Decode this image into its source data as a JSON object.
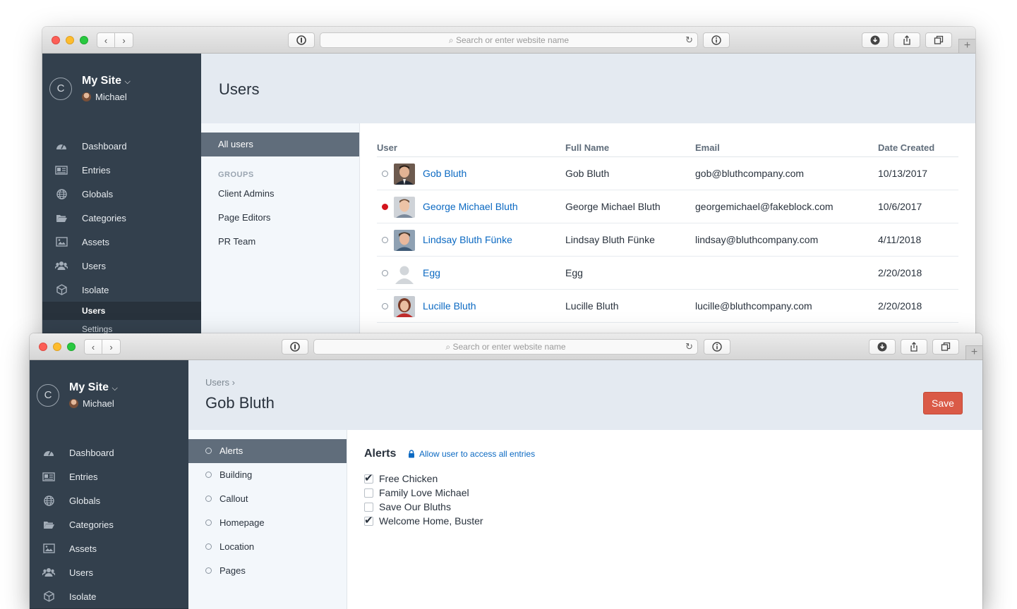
{
  "browser": {
    "address_placeholder": "Search or enter website name"
  },
  "site": {
    "name": "My Site",
    "user": "Michael",
    "logo_letter": "C"
  },
  "nav": {
    "items": [
      {
        "label": "Dashboard",
        "icon": "dashboard-icon"
      },
      {
        "label": "Entries",
        "icon": "entries-icon"
      },
      {
        "label": "Globals",
        "icon": "globe-icon"
      },
      {
        "label": "Categories",
        "icon": "folder-icon"
      },
      {
        "label": "Assets",
        "icon": "image-icon"
      },
      {
        "label": "Users",
        "icon": "users-icon"
      },
      {
        "label": "Isolate",
        "icon": "cube-icon"
      }
    ],
    "subitems": [
      {
        "label": "Users"
      },
      {
        "label": "Settings"
      }
    ]
  },
  "users_page": {
    "title": "Users",
    "sources": {
      "all_users": "All users",
      "groups_heading": "GROUPS",
      "groups": [
        "Client Admins",
        "Page Editors",
        "PR Team"
      ]
    },
    "columns": [
      "User",
      "Full Name",
      "Email",
      "Date Created"
    ],
    "rows": [
      {
        "user": "Gob Bluth",
        "full_name": "Gob Bluth",
        "email": "gob@bluthcompany.com",
        "date": "10/13/2017",
        "status": "off"
      },
      {
        "user": "George Michael Bluth",
        "full_name": "George Michael Bluth",
        "email": "georgemichael@fakeblock.com",
        "date": "10/6/2017",
        "status": "on"
      },
      {
        "user": "Lindsay Bluth Fünke",
        "full_name": "Lindsay Bluth Fünke",
        "email": "lindsay@bluthcompany.com",
        "date": "4/11/2018",
        "status": "off"
      },
      {
        "user": "Egg",
        "full_name": "Egg",
        "email": "",
        "date": "2/20/2018",
        "status": "off"
      },
      {
        "user": "Lucille Bluth",
        "full_name": "Lucille Bluth",
        "email": "lucille@bluthcompany.com",
        "date": "2/20/2018",
        "status": "off"
      }
    ]
  },
  "edit_page": {
    "breadcrumb": "Users",
    "title": "Gob Bluth",
    "save_label": "Save",
    "sections": [
      "Alerts",
      "Building",
      "Callout",
      "Homepage",
      "Location",
      "Pages"
    ],
    "active_section": "Alerts",
    "permissions": {
      "heading": "Alerts",
      "access_link": "Allow user to access all entries",
      "entries": [
        {
          "label": "Free Chicken",
          "checked": true
        },
        {
          "label": "Family Love Michael",
          "checked": false
        },
        {
          "label": "Save Our Bluths",
          "checked": false
        },
        {
          "label": "Welcome Home, Buster",
          "checked": true
        }
      ]
    }
  },
  "colors": {
    "sidebar": "#33404d",
    "header": "#e4eaf1",
    "link": "#0b69c2",
    "save": "#da5a47",
    "status_active": "#d3141c"
  }
}
